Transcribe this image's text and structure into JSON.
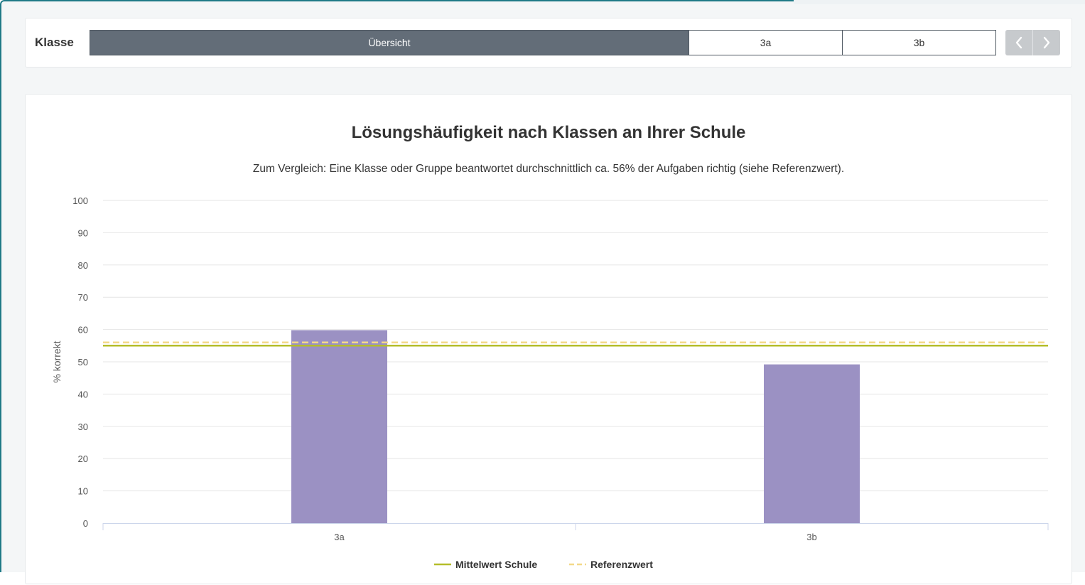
{
  "class_selector": {
    "label": "Klasse",
    "tabs": [
      {
        "label": "Übersicht",
        "active": true
      },
      {
        "label": "3a",
        "active": false
      },
      {
        "label": "3b",
        "active": false
      }
    ],
    "prev_icon": "chevron-left-icon",
    "next_icon": "chevron-right-icon"
  },
  "colors": {
    "bar": "#9b91c3",
    "school_mean": "#b5bd2a",
    "reference": "#f3d98a",
    "active_tab": "#636d78"
  },
  "chart_data": {
    "type": "bar",
    "title": "Lösungshäufigkeit nach Klassen an Ihrer Schule",
    "subtitle": "Zum Vergleich: Eine Klasse oder Gruppe beantwortet durchschnittlich ca. 56% der Aufgaben richtig (siehe Referenzwert).",
    "categories": [
      "3a",
      "3b"
    ],
    "values": [
      59.8,
      49.2
    ],
    "ylabel": "% korrekt",
    "xlabel": "",
    "ylim": [
      0,
      100
    ],
    "yticks": [
      "0",
      "10",
      "20",
      "30",
      "40",
      "50",
      "60",
      "70",
      "80",
      "90",
      "100"
    ],
    "grid": true,
    "reference_lines": [
      {
        "name": "Mittelwert Schule",
        "value": 55,
        "style": "solid"
      },
      {
        "name": "Referenzwert",
        "value": 56,
        "style": "dashed"
      }
    ],
    "legend_position": "bottom"
  }
}
